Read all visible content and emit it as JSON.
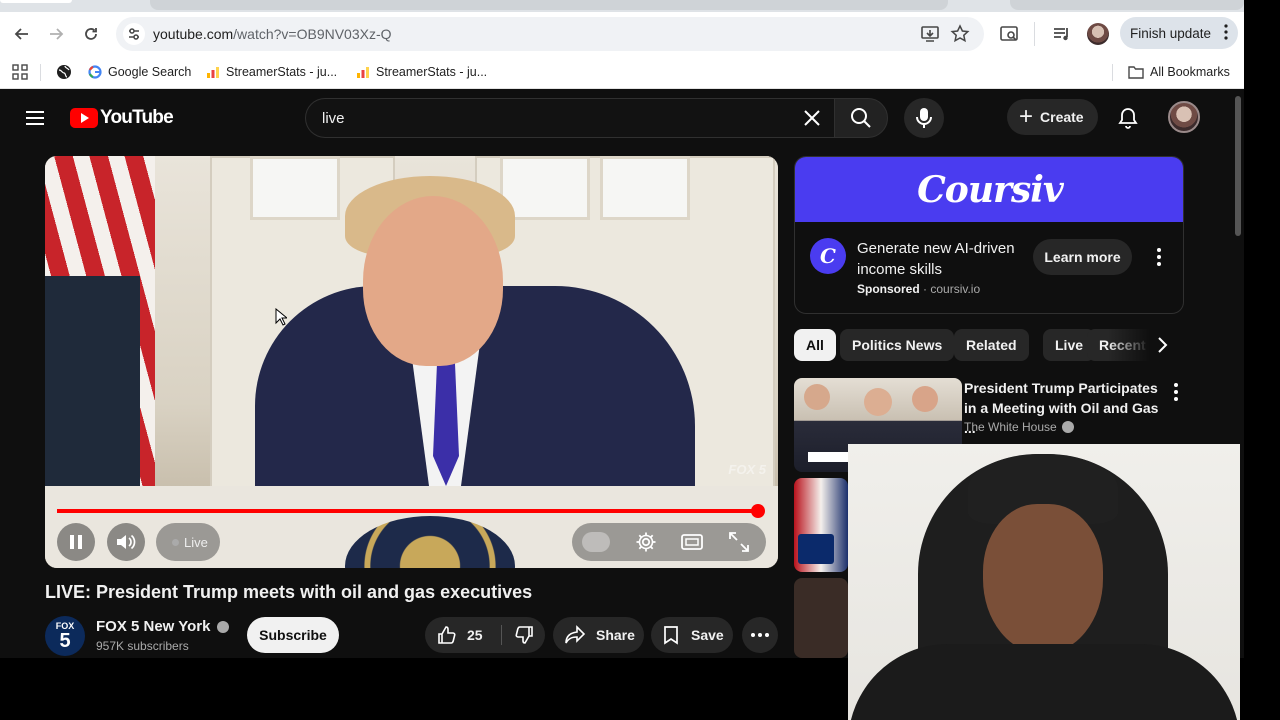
{
  "browser": {
    "url_domain": "youtube.com",
    "url_path": "/watch?v=OB9NV03Xz-Q",
    "finish_update_label": "Finish update",
    "bookmarks": [
      {
        "label": "Google Search"
      },
      {
        "label": "StreamerStats - ju..."
      },
      {
        "label": "StreamerStats - ju..."
      }
    ],
    "all_bookmarks_label": "All Bookmarks"
  },
  "youtube": {
    "logo_text": "YouTube",
    "search_query": "live",
    "create_label": "Create"
  },
  "player": {
    "live_label": "Live",
    "watermark": "FOX 5",
    "progress_fraction": 0.99
  },
  "video": {
    "title": "LIVE: President Trump meets with oil and gas executives",
    "channel_name": "FOX 5 New York",
    "channel_logo_top": "FOX",
    "channel_logo_num": "5",
    "subscribers": "957K subscribers",
    "subscribe_label": "Subscribe",
    "like_count": "25",
    "share_label": "Share",
    "save_label": "Save"
  },
  "ad": {
    "brand": "Coursiv",
    "headline": "Generate new AI-driven income skills",
    "sponsored_label": "Sponsored",
    "domain": "coursiv.io",
    "cta_label": "Learn more"
  },
  "chips": [
    {
      "label": "All",
      "active": true
    },
    {
      "label": "Politics News"
    },
    {
      "label": "Related"
    },
    {
      "label": "Live"
    },
    {
      "label": "Recent"
    }
  ],
  "recommendations": [
    {
      "title": "President Trump Participates in a Meeting with Oil and Gas ...",
      "channel": "The White House"
    }
  ],
  "colors": {
    "accent_red": "#ff0000",
    "ad_purple": "#4a3cf0",
    "bg_dark": "#0f0f0f"
  }
}
